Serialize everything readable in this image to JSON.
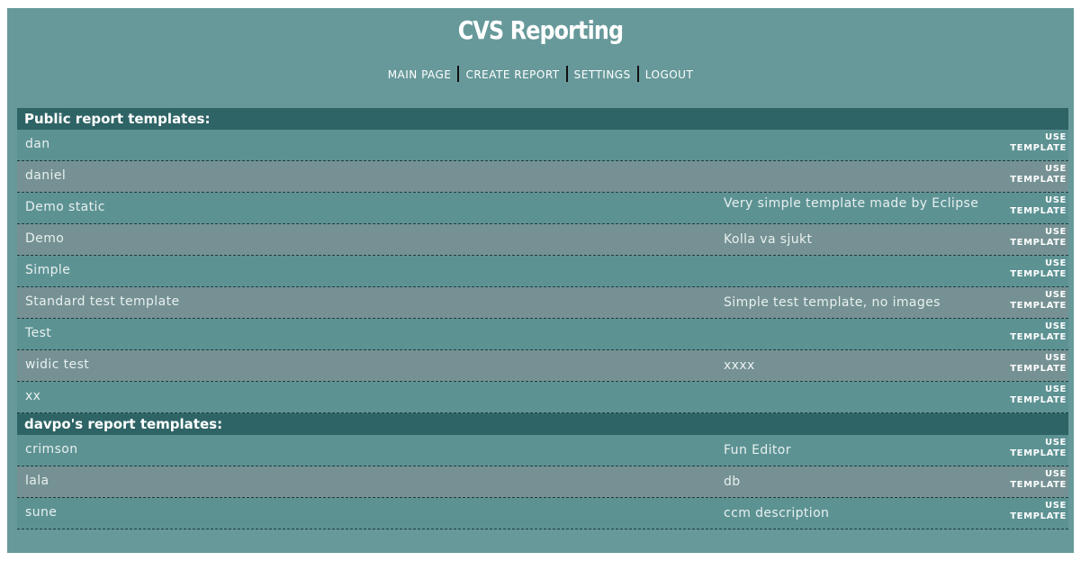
{
  "app": {
    "title": "CVS Reporting"
  },
  "nav": {
    "items": [
      {
        "label": "MAIN PAGE"
      },
      {
        "label": "CREATE REPORT"
      },
      {
        "label": "SETTINGS"
      },
      {
        "label": "LOGOUT"
      }
    ]
  },
  "use_label": {
    "line1": "USE",
    "line2": "TEMPLATE"
  },
  "sections": [
    {
      "title": "Public report templates:",
      "rows": [
        {
          "name": "dan",
          "description": ""
        },
        {
          "name": "daniel",
          "description": ""
        },
        {
          "name": "Demo static",
          "description": "Very simple template made by Eclipse"
        },
        {
          "name": "Demo",
          "description": "Kolla va sjukt"
        },
        {
          "name": "Simple",
          "description": ""
        },
        {
          "name": "Standard test template",
          "description": "Simple test template, no images"
        },
        {
          "name": "Test",
          "description": ""
        },
        {
          "name": "widic test",
          "description": "xxxx"
        },
        {
          "name": "xx",
          "description": ""
        }
      ]
    },
    {
      "title": "davpo's report templates:",
      "rows": [
        {
          "name": "crimson",
          "description": "Fun Editor"
        },
        {
          "name": "lala",
          "description": "db"
        },
        {
          "name": "sune",
          "description": "ccm description"
        }
      ]
    }
  ]
}
